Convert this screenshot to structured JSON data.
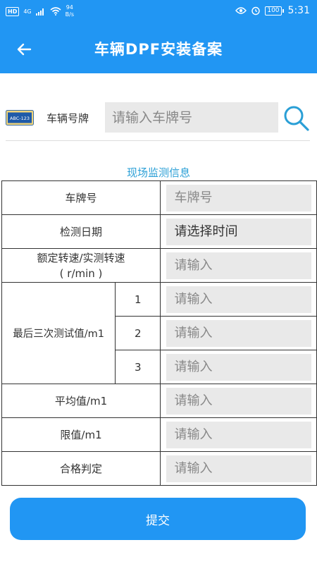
{
  "status_bar": {
    "hd_badge": "HD",
    "network": "4G",
    "speed_value": "94",
    "speed_unit": "B/s",
    "battery": "100",
    "time": "5:31"
  },
  "header": {
    "title": "车辆DPF安装备案"
  },
  "search": {
    "plate_icon_text": "ABC-123",
    "label": "车辆号牌",
    "placeholder": "请输入车牌号"
  },
  "section": {
    "title": "现场监测信息"
  },
  "table": {
    "plate_label": "车牌号",
    "plate_placeholder": "车牌号",
    "date_label": "检测日期",
    "date_value": "请选择时间",
    "speed_label_line1": "额定转速/实测转速",
    "speed_label_line2": "( r/min )",
    "speed_placeholder": "请输入",
    "last3_label": "最后三次测试值/m1",
    "last3_rows": [
      {
        "index": "1",
        "placeholder": "请输入"
      },
      {
        "index": "2",
        "placeholder": "请输入"
      },
      {
        "index": "3",
        "placeholder": "请输入"
      }
    ],
    "avg_label": "平均值/m1",
    "avg_placeholder": "请输入",
    "limit_label": "限值/m1",
    "limit_placeholder": "请输入",
    "result_label": "合格判定",
    "result_placeholder": "请输入"
  },
  "submit": {
    "label": "提交"
  },
  "colors": {
    "primary": "#2196f3",
    "section_title": "#2a9fd6",
    "input_bg": "#e9e9e9"
  }
}
